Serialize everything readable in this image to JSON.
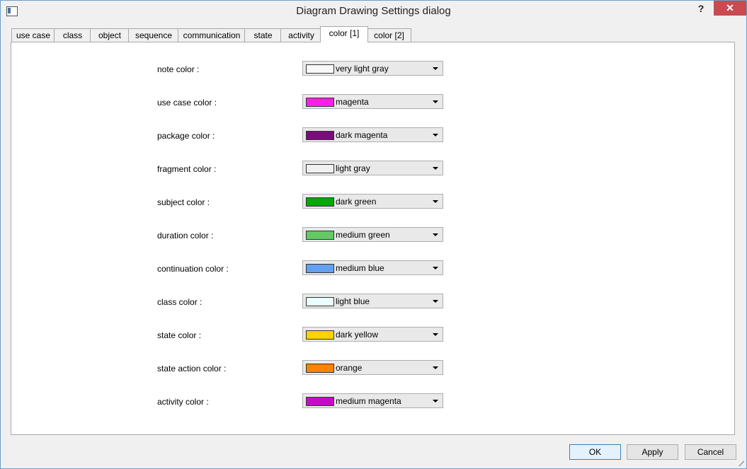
{
  "window": {
    "title": "Diagram Drawing Settings dialog",
    "help_label": "?",
    "close_label": "✕"
  },
  "tabs": [
    {
      "label": "use case"
    },
    {
      "label": "class"
    },
    {
      "label": "object"
    },
    {
      "label": "sequence"
    },
    {
      "label": "communication"
    },
    {
      "label": "state"
    },
    {
      "label": "activity"
    },
    {
      "label": "color [1]",
      "active": true
    },
    {
      "label": "color [2]"
    }
  ],
  "settings": [
    {
      "label": "note color :",
      "value": "very light gray",
      "color": "#f8f8f8"
    },
    {
      "label": "use case color :",
      "value": "magenta",
      "color": "#ff1ee6"
    },
    {
      "label": "package color :",
      "value": "dark magenta",
      "color": "#7d0a7d"
    },
    {
      "label": "fragment color :",
      "value": "light gray",
      "color": "#f0f0f0"
    },
    {
      "label": "subject color :",
      "value": "dark green",
      "color": "#0aa50a"
    },
    {
      "label": "duration color :",
      "value": "medium green",
      "color": "#64c864"
    },
    {
      "label": "continuation color :",
      "value": "medium blue",
      "color": "#64a0f0"
    },
    {
      "label": "class color :",
      "value": "light blue",
      "color": "#eaffff"
    },
    {
      "label": "state color :",
      "value": "dark yellow",
      "color": "#ffd200"
    },
    {
      "label": "state action color :",
      "value": "orange",
      "color": "#ff8200"
    },
    {
      "label": "activity color :",
      "value": "medium magenta",
      "color": "#c80ac8"
    }
  ],
  "buttons": {
    "ok": "OK",
    "apply": "Apply",
    "cancel": "Cancel"
  }
}
